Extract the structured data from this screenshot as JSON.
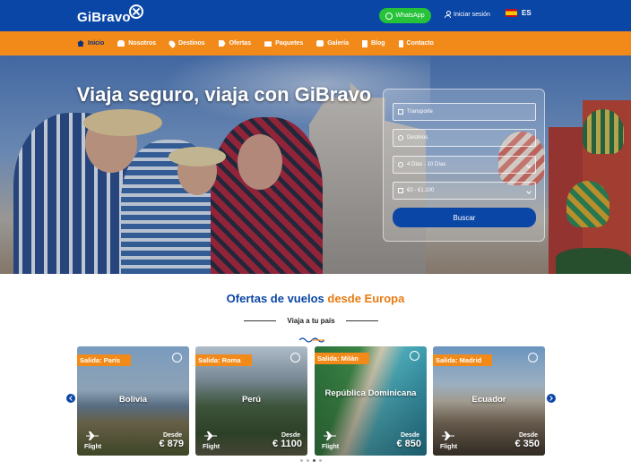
{
  "brand": {
    "name": "GiBravo"
  },
  "topbar": {
    "whatsapp_label": "WhatsApp",
    "login_label": "Iniciar sesión",
    "lang": "ES"
  },
  "nav": {
    "items": [
      {
        "label": "Inicio",
        "icon": "home-icon"
      },
      {
        "label": "Nosotros",
        "icon": "group-icon"
      },
      {
        "label": "Destinos",
        "icon": "map-pin-icon"
      },
      {
        "label": "Ofertas",
        "icon": "tag-icon"
      },
      {
        "label": "Paquetes",
        "icon": "gift-icon"
      },
      {
        "label": "Galería",
        "icon": "camera-icon"
      },
      {
        "label": "Blog",
        "icon": "document-icon"
      },
      {
        "label": "Contacto",
        "icon": "phone-icon"
      }
    ]
  },
  "hero": {
    "title": "Viaja seguro, viaja con GiBravo",
    "search": {
      "transport": "Transporte",
      "destination": "Destinos",
      "duration": "4 Días - 10 Días",
      "budget": "€0 - €1.100",
      "button": "Buscar"
    }
  },
  "offers": {
    "title_part1": "Ofertas de ",
    "title_part2": "vuelos ",
    "title_part3": "desde Europa",
    "subtitle": "Viaja a tu país",
    "cards": [
      {
        "badge": "Salida: París",
        "destination": "Bolivia",
        "from_label": "Desde",
        "price": "€ 879",
        "type": "Flight"
      },
      {
        "badge": "Salida: Roma",
        "destination": "Perú",
        "from_label": "Desde",
        "price": "€ 1100",
        "type": "Flight"
      },
      {
        "badge": "Salida: Milán",
        "destination": "República Dominicana",
        "from_label": "Desde",
        "price": "€ 850",
        "type": "Flight"
      },
      {
        "badge": "Salida: Madrid",
        "destination": "Ecuador",
        "from_label": "Desde",
        "price": "€ 350",
        "type": "Flight"
      }
    ]
  },
  "colors": {
    "primary_blue": "#0a46a6",
    "accent_orange": "#f28a1a",
    "whatsapp_green": "#25c23a"
  }
}
